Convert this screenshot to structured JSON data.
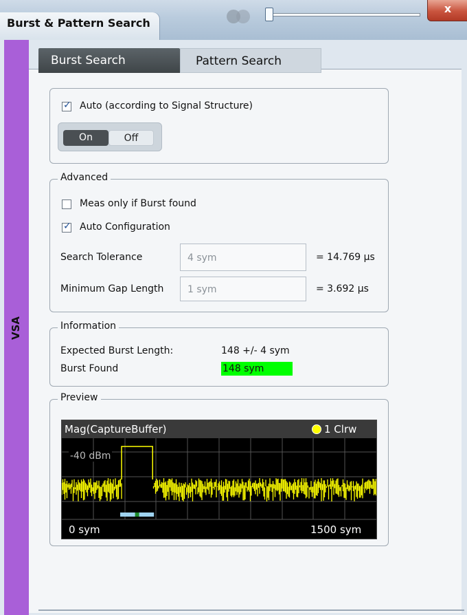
{
  "window": {
    "title": "Burst & Pattern Search",
    "close_label": "x"
  },
  "side_tab": {
    "label": "VSA"
  },
  "tabs": [
    {
      "label": "Burst Search",
      "active": true
    },
    {
      "label": "Pattern Search",
      "active": false
    }
  ],
  "auto_section": {
    "checkbox_label": "Auto (according to Signal Structure)",
    "checked": true,
    "toggle_on": "On",
    "toggle_off": "Off",
    "selected": "On"
  },
  "advanced": {
    "legend": "Advanced",
    "meas_only_label": "Meas only if Burst found",
    "meas_only_checked": false,
    "auto_config_label": "Auto Configuration",
    "auto_config_checked": true,
    "search_tolerance": {
      "label": "Search Tolerance",
      "value": "4 sym",
      "result": "= 14.769 µs"
    },
    "min_gap": {
      "label": "Minimum Gap Length",
      "value": "1 sym",
      "result": "= 3.692 µs"
    }
  },
  "information": {
    "legend": "Information",
    "expected_label": "Expected Burst Length:",
    "expected_value": "148 +/- 4 sym",
    "found_label": "Burst Found",
    "found_value": "148 sym",
    "found_color": "#00ff00"
  },
  "preview": {
    "legend": "Preview",
    "trace_title": "Mag(CaptureBuffer)",
    "trace_badge": "1 Clrw",
    "ref_level": "-40 dBm",
    "x_start": "0 sym",
    "x_end": "1500 sym",
    "trace_color": "#ffff00"
  },
  "chart_data": {
    "type": "line",
    "title": "Mag(CaptureBuffer)",
    "xlabel": "",
    "ylabel": "",
    "xlim": [
      0,
      1500
    ],
    "tick_labels": [
      "0 sym",
      "1500 sym",
      "-40 dBm"
    ],
    "series": [
      {
        "name": "1 Clrw",
        "description_points": [
          [
            0,
            "noise"
          ],
          [
            285,
            "burst start"
          ],
          [
            433,
            "burst end"
          ],
          [
            1500,
            "noise"
          ]
        ]
      }
    ]
  }
}
